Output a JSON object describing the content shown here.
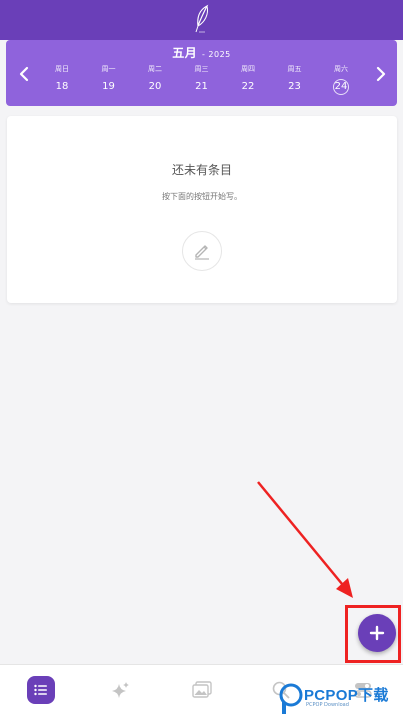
{
  "calendar": {
    "month": "五月",
    "year": "- 2025",
    "days": [
      {
        "weekday": "周日",
        "date": "18",
        "selected": false
      },
      {
        "weekday": "周一",
        "date": "19",
        "selected": false
      },
      {
        "weekday": "周二",
        "date": "20",
        "selected": false
      },
      {
        "weekday": "周三",
        "date": "21",
        "selected": false
      },
      {
        "weekday": "周四",
        "date": "22",
        "selected": false
      },
      {
        "weekday": "周五",
        "date": "23",
        "selected": false
      },
      {
        "weekday": "周六",
        "date": "24",
        "selected": true
      }
    ]
  },
  "empty_state": {
    "title": "还未有条目",
    "subtitle": "按下面的按钮开始写。"
  },
  "bottom_nav": {
    "items": [
      "entries-icon",
      "sparkle-icon",
      "gallery-icon",
      "search-icon",
      "settings-icon"
    ],
    "active": "entries-icon"
  },
  "watermark": {
    "brand": "PCPOP下载",
    "small": "PCPOP Download"
  },
  "colors": {
    "primary": "#6a3fb8",
    "calendar_bg": "#8f63dc",
    "annotation": "#ee2222"
  }
}
